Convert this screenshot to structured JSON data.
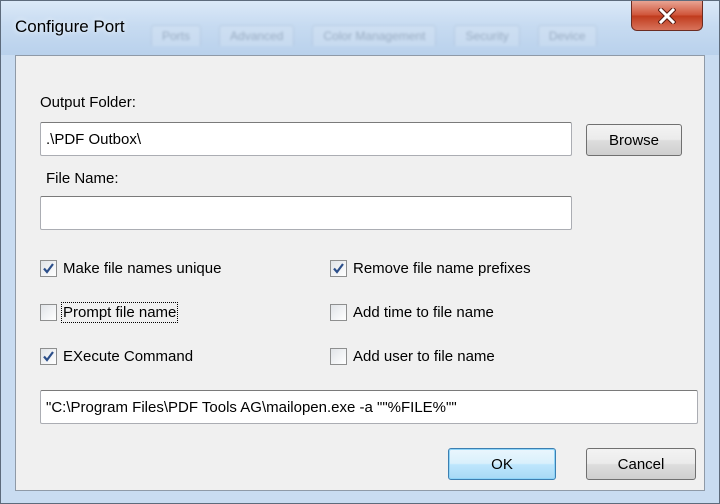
{
  "window": {
    "title": "Configure Port",
    "background_tabs": [
      "Ports",
      "Advanced",
      "Color Management",
      "Security",
      "Device"
    ]
  },
  "output_folder": {
    "label": "Output Folder:",
    "value": ".\\PDF Outbox\\",
    "browse_label": "Browse"
  },
  "file_name": {
    "label": "File Name:",
    "value": ""
  },
  "options": {
    "make_unique": {
      "label": "Make file names unique",
      "checked": true
    },
    "remove_prefixes": {
      "label": "Remove file name prefixes",
      "checked": true
    },
    "prompt_file_name": {
      "label": "Prompt file name",
      "checked": false
    },
    "add_time": {
      "label": "Add time to file name",
      "checked": false
    },
    "execute_command": {
      "label": "EXecute Command",
      "checked": true
    },
    "add_user": {
      "label": "Add user to file name",
      "checked": false
    }
  },
  "command": {
    "value": "\"C:\\Program Files\\PDF Tools AG\\mailopen.exe -a \"\"%FILE%\"\""
  },
  "buttons": {
    "ok": "OK",
    "cancel": "Cancel"
  },
  "colors": {
    "frame": "#c9dcf1",
    "close": "#c7442a",
    "dialog_face": "#f0f0f0",
    "check": "#2c4f8a"
  }
}
